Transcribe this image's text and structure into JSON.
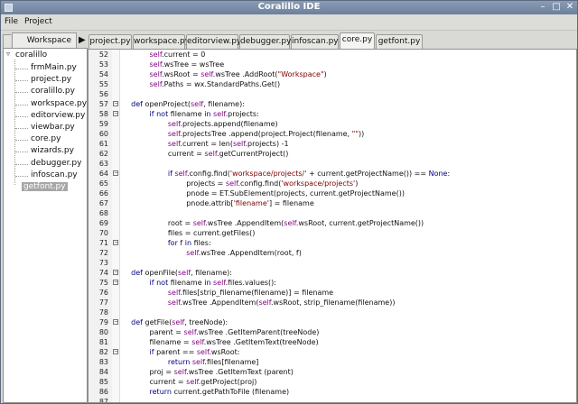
{
  "window": {
    "title": "Coralillo IDE",
    "controls": [
      "minimize",
      "maximize",
      "close"
    ]
  },
  "menu": [
    {
      "label": "File"
    },
    {
      "label": "Project"
    }
  ],
  "left_panel": {
    "tab_label": "Workspace",
    "root_label": "coralillo",
    "files": [
      "frmMain.py",
      "project.py",
      "coralillo.py",
      "workspace.py",
      "editorview.py",
      "viewbar.py",
      "core.py",
      "wizards.py",
      "debugger.py",
      "infoscan.py"
    ],
    "selected_file": "getfont.py"
  },
  "editor_tabs": [
    {
      "label": "project.py",
      "active": false
    },
    {
      "label": "workspace.py",
      "active": false
    },
    {
      "label": "editorview.py",
      "active": false
    },
    {
      "label": "debugger.py",
      "active": false
    },
    {
      "label": "infoscan.py",
      "active": false
    },
    {
      "label": "core.py",
      "active": true
    },
    {
      "label": "getfont.py",
      "active": false
    }
  ],
  "code_lines": [
    {
      "num": "52",
      "fold": "",
      "text": "            self.current = 0"
    },
    {
      "num": "53",
      "fold": "",
      "text": "            self.wsTree = wsTree"
    },
    {
      "num": "54",
      "fold": "",
      "text": "            self.wsRoot = self.wsTree .AddRoot(\"Workspace\")"
    },
    {
      "num": "55",
      "fold": "",
      "text": "            self.Paths = wx.StandardPaths.Get()"
    },
    {
      "num": "56",
      "fold": "",
      "text": ""
    },
    {
      "num": "57",
      "fold": "minus",
      "text": "    def openProject(self, filename):"
    },
    {
      "num": "58",
      "fold": "minus",
      "text": "            if not filename in self.projects:"
    },
    {
      "num": "59",
      "fold": "",
      "text": "                    self.projects.append(filename)"
    },
    {
      "num": "60",
      "fold": "",
      "text": "                    self.projectsTree .append(project.Project(filename, \"\"))"
    },
    {
      "num": "61",
      "fold": "",
      "text": "                    self.current = len(self.projects) -1"
    },
    {
      "num": "62",
      "fold": "",
      "text": "                    current = self.getCurrentProject()"
    },
    {
      "num": "63",
      "fold": "",
      "text": ""
    },
    {
      "num": "64",
      "fold": "minus",
      "text": "                    if self.config.find('workspace/projects/' + current.getProjectName()) == None:"
    },
    {
      "num": "65",
      "fold": "",
      "text": "                            projects = self.config.find('workspace/projects')"
    },
    {
      "num": "66",
      "fold": "",
      "text": "                            pnode = ET.SubElement(projects, current.getProjectName())"
    },
    {
      "num": "67",
      "fold": "",
      "text": "                            pnode.attrib['filename'] = filename"
    },
    {
      "num": "68",
      "fold": "",
      "text": ""
    },
    {
      "num": "69",
      "fold": "",
      "text": "                    root = self.wsTree .AppendItem(self.wsRoot, current.getProjectName())"
    },
    {
      "num": "70",
      "fold": "",
      "text": "                    files = current.getFiles()"
    },
    {
      "num": "71",
      "fold": "minus",
      "text": "                    for f in files:"
    },
    {
      "num": "72",
      "fold": "",
      "text": "                            self.wsTree .AppendItem(root, f)"
    },
    {
      "num": "73",
      "fold": "",
      "text": ""
    },
    {
      "num": "74",
      "fold": "minus",
      "text": "    def openFile(self, filename):"
    },
    {
      "num": "75",
      "fold": "minus",
      "text": "            if not filename in self.files.values():"
    },
    {
      "num": "76",
      "fold": "",
      "text": "                    self.files[strip_filename(filename)] = filename"
    },
    {
      "num": "77",
      "fold": "",
      "text": "                    self.wsTree .AppendItem(self.wsRoot, strip_filename(filename))"
    },
    {
      "num": "78",
      "fold": "",
      "text": ""
    },
    {
      "num": "79",
      "fold": "minus",
      "text": "    def getFile(self, treeNode):"
    },
    {
      "num": "80",
      "fold": "",
      "text": "            parent = self.wsTree .GetItemParent(treeNode)"
    },
    {
      "num": "81",
      "fold": "",
      "text": "            filename = self.wsTree .GetItemText(treeNode)"
    },
    {
      "num": "82",
      "fold": "minus",
      "text": "            if parent == self.wsRoot:"
    },
    {
      "num": "83",
      "fold": "",
      "text": "                    return self.files[filename]"
    },
    {
      "num": "84",
      "fold": "",
      "text": "            proj = self.wsTree .GetItemText (parent)"
    },
    {
      "num": "85",
      "fold": "",
      "text": "            current = self.getProject(proj)"
    },
    {
      "num": "86",
      "fold": "",
      "text": "            return current.getPathToFile (filename)"
    },
    {
      "num": "87",
      "fold": "",
      "text": ""
    }
  ],
  "colors": {
    "titlebar": "#7a8ba6",
    "keyword": "#00007f",
    "self": "#7f007f",
    "string": "#7f0000"
  }
}
